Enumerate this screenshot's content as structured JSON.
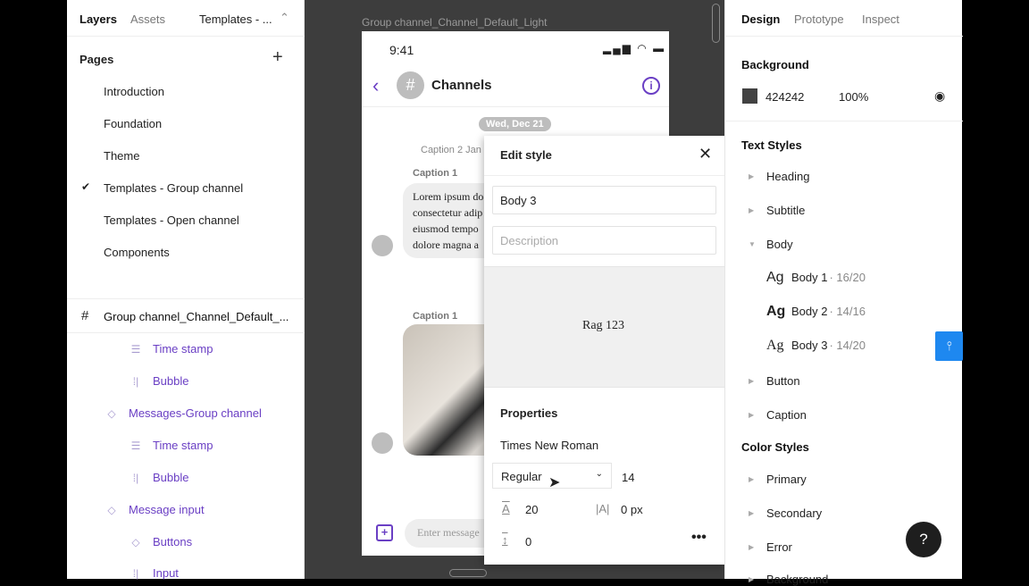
{
  "left": {
    "tabs": [
      "Layers",
      "Assets",
      "Templates - ..."
    ],
    "pages_title": "Pages",
    "pages": [
      "Introduction",
      "Foundation",
      "Theme",
      "Templates - Group channel",
      "Templates - Open channel",
      "Components"
    ],
    "current_page": "Templates - Group channel",
    "frame": "Group channel_Channel_Default_...",
    "layers": [
      {
        "label": "Time stamp",
        "icon": "text-lines-icon",
        "indent": 2
      },
      {
        "label": "Bubble",
        "icon": "auto-layout-icon",
        "indent": 2
      },
      {
        "label": "Messages-Group channel",
        "icon": "component-instance-icon",
        "indent": 1
      },
      {
        "label": "Time stamp",
        "icon": "text-lines-icon",
        "indent": 2
      },
      {
        "label": "Bubble",
        "icon": "auto-layout-icon",
        "indent": 2
      },
      {
        "label": "Message input",
        "icon": "component-instance-icon",
        "indent": 1
      },
      {
        "label": "Buttons",
        "icon": "component-instance-icon",
        "indent": 2
      },
      {
        "label": "Input",
        "icon": "auto-layout-icon",
        "indent": 2
      }
    ]
  },
  "canvas": {
    "frame_label": "Group channel_Channel_Default_Light",
    "phone": {
      "time": "9:41",
      "title": "Channels",
      "date": "Wed, Dec 21",
      "caption2": "Caption 2 Jan",
      "caption1": "Caption 1",
      "caption1b": "Caption 1",
      "lorem": [
        "Lorem ipsum do",
        "consectetur adip",
        "eiusmod tempo",
        "dolore magna a"
      ],
      "input_placeholder": "Enter message"
    },
    "accent": "#6a3fc4"
  },
  "edit_style": {
    "title": "Edit style",
    "name_value": "Body 3",
    "description_placeholder": "Description",
    "preview": "Rag 123",
    "properties_title": "Properties",
    "font_family": "Times New Roman",
    "weight": "Regular",
    "size": "14",
    "line_height": "20",
    "letter_spacing": "0 px",
    "paragraph_spacing": "0"
  },
  "right": {
    "tabs": [
      "Design",
      "Prototype",
      "Inspect"
    ],
    "background_title": "Background",
    "bg_color": "424242",
    "bg_opacity": "100%",
    "text_styles_title": "Text Styles",
    "text_groups": [
      "Heading",
      "Subtitle",
      "Body"
    ],
    "body_styles": [
      {
        "name": "Body 1",
        "meta": "· 16/20"
      },
      {
        "name": "Body 2",
        "meta": "· 14/16"
      },
      {
        "name": "Body 3",
        "meta": "· 14/20"
      }
    ],
    "ag": "Ag",
    "text_groups2": [
      "Button",
      "Caption"
    ],
    "color_styles_title": "Color Styles",
    "color_groups": [
      "Primary",
      "Secondary",
      "Error",
      "Background"
    ],
    "help": "?",
    "highlight": "#1e88f0"
  }
}
